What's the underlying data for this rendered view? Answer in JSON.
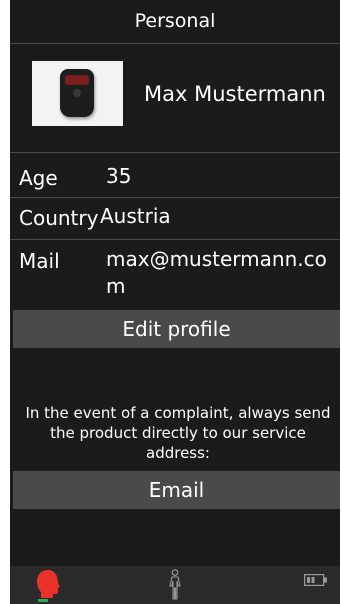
{
  "header": {
    "title": "Personal"
  },
  "profile": {
    "name": "Max Mustermann",
    "image_icon": "device-photo"
  },
  "details": {
    "age_label": "Age",
    "age_value": "35",
    "country_label": "Country",
    "country_value": "Austria",
    "mail_label": "Mail",
    "mail_value_line1": "max@mustermann.co",
    "mail_value_line2": "m"
  },
  "buttons": {
    "edit_profile": "Edit profile",
    "email": "Email"
  },
  "notice": {
    "text": "In the event of a complaint, always send the product directly to our service address:"
  },
  "tabbar": {
    "tabs": [
      {
        "icon": "head-icon",
        "active": true,
        "color": "#e8322a"
      },
      {
        "icon": "body-icon",
        "active": false
      },
      {
        "icon": "battery-icon",
        "active": false
      }
    ],
    "active_color": "#2fa84f"
  },
  "colors": {
    "background": "#1b1b1b",
    "button": "#4a4a4a",
    "divider": "#4a4a4a",
    "text": "#ffffff"
  }
}
